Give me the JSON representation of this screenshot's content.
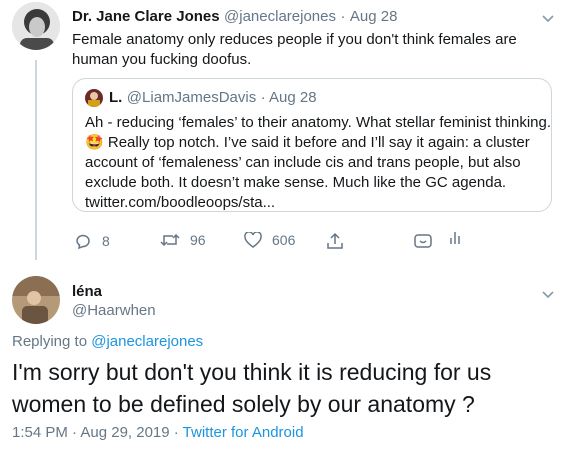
{
  "tweet1": {
    "name": "Dr. Jane Clare Jones",
    "handle": "@janeclarejones",
    "sep": "·",
    "date": "Aug 28",
    "text": "Female anatomy only reduces people if you don't think females are human you fucking doofus."
  },
  "quoted": {
    "name": "L.",
    "handle": "@LiamJamesDavis",
    "date": "· Aug 28",
    "line1": "Ah - reducing ‘females’ to their anatomy. What stellar feminist thinking.",
    "emoji": "🤩",
    "line2": " Really top notch. I’ve said it before and I’ll say it again: a cluster",
    "line3": "account of ‘femaleness’ can include cis and trans people, but also",
    "line4": "exclude both. It doesn’t make sense. Much like the GC agenda.",
    "link": "twitter.com/boodleoops/sta..."
  },
  "actions": {
    "reply_count": "8",
    "retweet_count": "96",
    "like_count": "606"
  },
  "tweet2": {
    "name": "léna",
    "handle": "@Haarwhen",
    "replying_prefix": "Replying to ",
    "replying_handle": "@janeclarejones",
    "text": "I'm sorry but don't you think it is reducing for us women to be defined solely by our anatomy ?",
    "time": "1:54 PM · Aug 29, 2019 · ",
    "source": "Twitter for Android"
  },
  "colors": {
    "link": "#1b95e0",
    "muted": "#657786",
    "border": "#ccd6dd"
  }
}
